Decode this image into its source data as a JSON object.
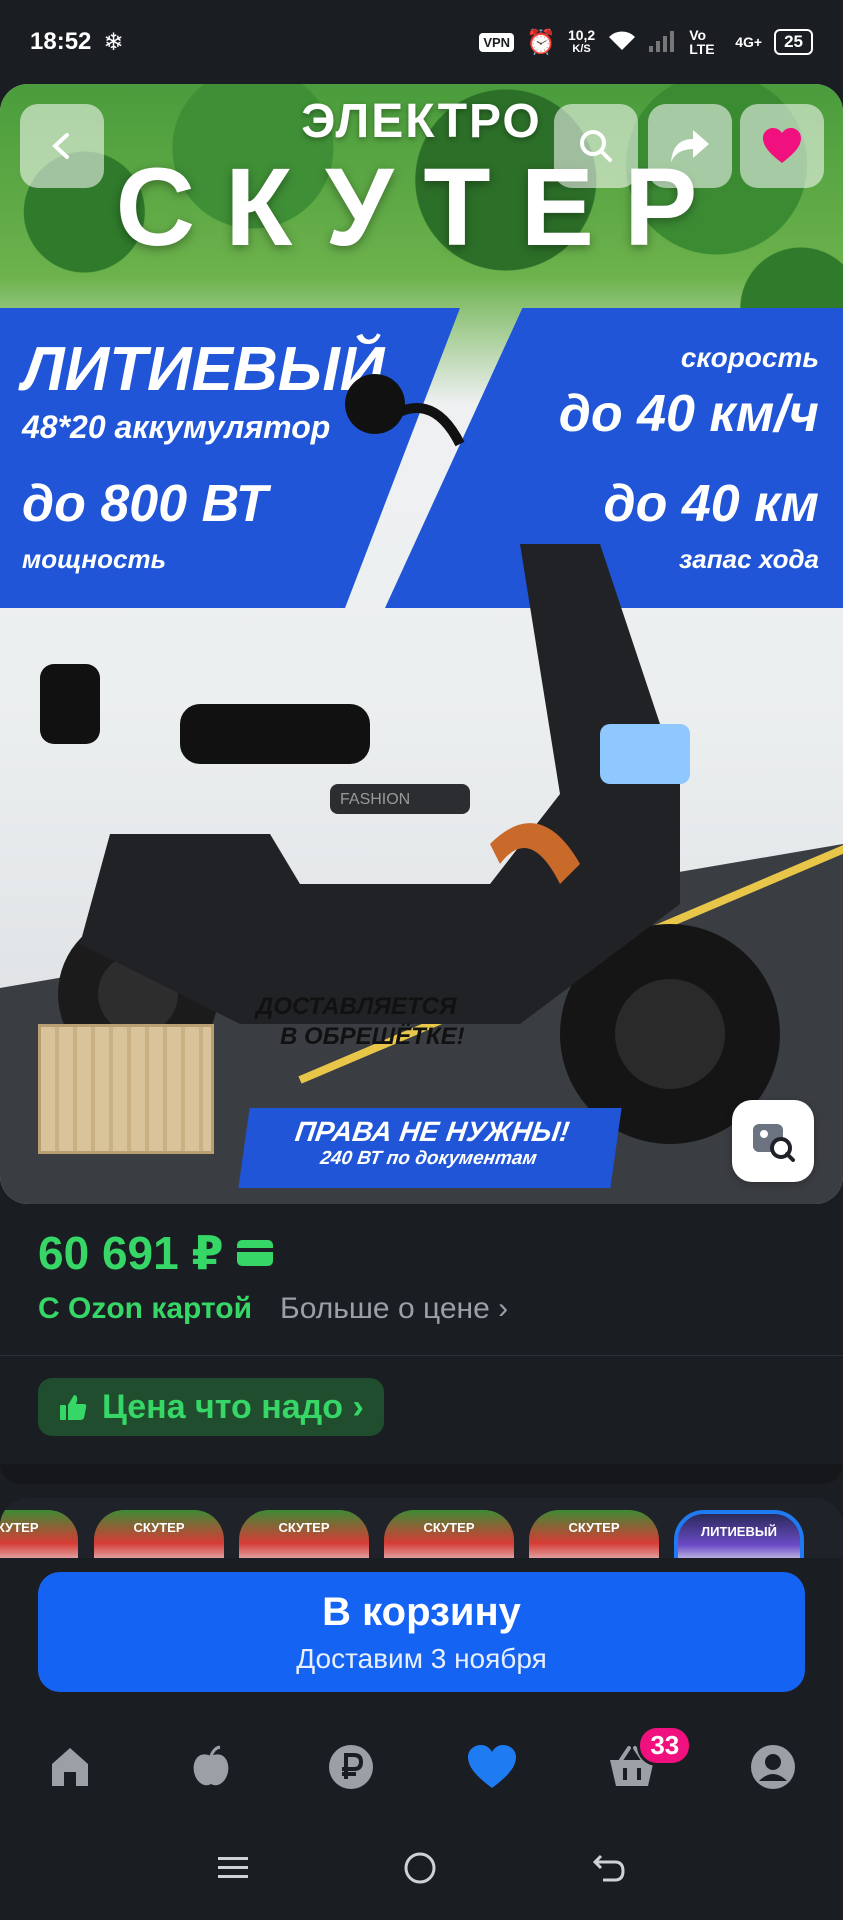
{
  "status_bar": {
    "time": "18:52",
    "vpn": "VPN",
    "speed_value": "10,2",
    "speed_unit": "K/S",
    "network_volte": "Vo LTE",
    "network_4g": "4G+",
    "battery": "25"
  },
  "hero": {
    "line1": "ЭЛЕКТРО",
    "line2": "СКУТЕР",
    "left_title": "ЛИТИЕВЫЙ",
    "left_sub": "48*20 аккумулятор",
    "left_power": "до 800 ВТ",
    "left_power_label": "мощность",
    "right_speed_label": "скорость",
    "right_speed": "до 40 км/ч",
    "right_range": "до 40 км",
    "right_range_label": "запас хода",
    "delivery_line1": "ДОСТАВЛЯЕТСЯ",
    "delivery_line2": "В ОБРЕШЁТКЕ!",
    "rights_title": "ПРАВА НЕ НУЖНЫ!",
    "rights_sub": "240 ВТ по документам",
    "scooter_brand": "FASHION"
  },
  "price": {
    "value": "60 691 ₽",
    "ozon_card": "С Ozon картой",
    "more": "Больше о цене ›",
    "deal_label": "Цена что надо ›"
  },
  "thumbnails": [
    {
      "label": "СКУТЕР"
    },
    {
      "label": "СКУТЕР"
    },
    {
      "label": "СКУТЕР"
    },
    {
      "label": "СКУТЕР"
    },
    {
      "label": "СКУТЕР"
    },
    {
      "label": "ЛИТИЕВЫЙ"
    }
  ],
  "cart": {
    "label": "В корзину",
    "delivery": "Доставим 3 ноября"
  },
  "nav": {
    "cart_badge": "33"
  },
  "colors": {
    "background": "#1a1d22",
    "price_green": "#36d667",
    "primary_blue": "#1463f3",
    "favorite_blue": "#1f7bf2",
    "badge_pink": "#f1117e",
    "banner_blue": "#1f55d6"
  },
  "icons": {
    "back": "back-arrow-icon",
    "search": "search-icon",
    "share": "share-icon",
    "favorite": "heart-icon",
    "lens": "image-search-icon",
    "home": "home-icon",
    "fresh": "apple-icon",
    "finance": "ruble-icon",
    "favorites": "heart-icon",
    "cart": "basket-icon",
    "profile": "profile-icon"
  }
}
